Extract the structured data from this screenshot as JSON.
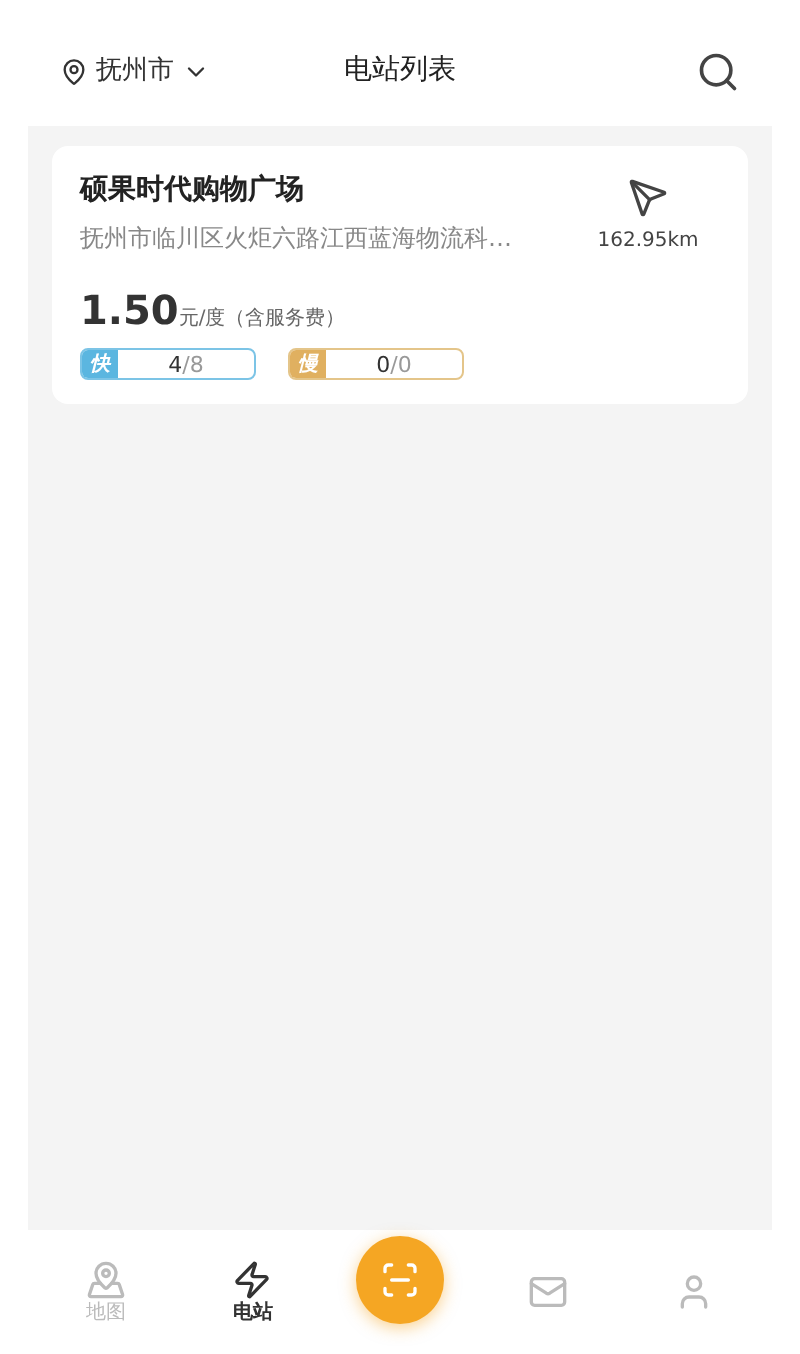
{
  "header": {
    "city": "抚州市",
    "title": "电站列表"
  },
  "stations": [
    {
      "name": "硕果时代购物广场",
      "address": "抚州市临川区火炬六路江西蓝海物流科…",
      "distance": "162.95km",
      "price": "1.50",
      "unit": "元/度（含服务费）",
      "chargers": [
        {
          "kind": "fast",
          "tag": "快",
          "free": "4",
          "total": "/8"
        },
        {
          "kind": "slow",
          "tag": "慢",
          "free": "0",
          "total": "/0"
        }
      ]
    }
  ],
  "nav": [
    {
      "kind": "map",
      "label": "地图",
      "selected": false
    },
    {
      "kind": "station",
      "label": "电站",
      "selected": true
    },
    {
      "kind": "scan"
    },
    {
      "kind": "message",
      "selected": false
    },
    {
      "kind": "profile",
      "selected": false
    }
  ]
}
